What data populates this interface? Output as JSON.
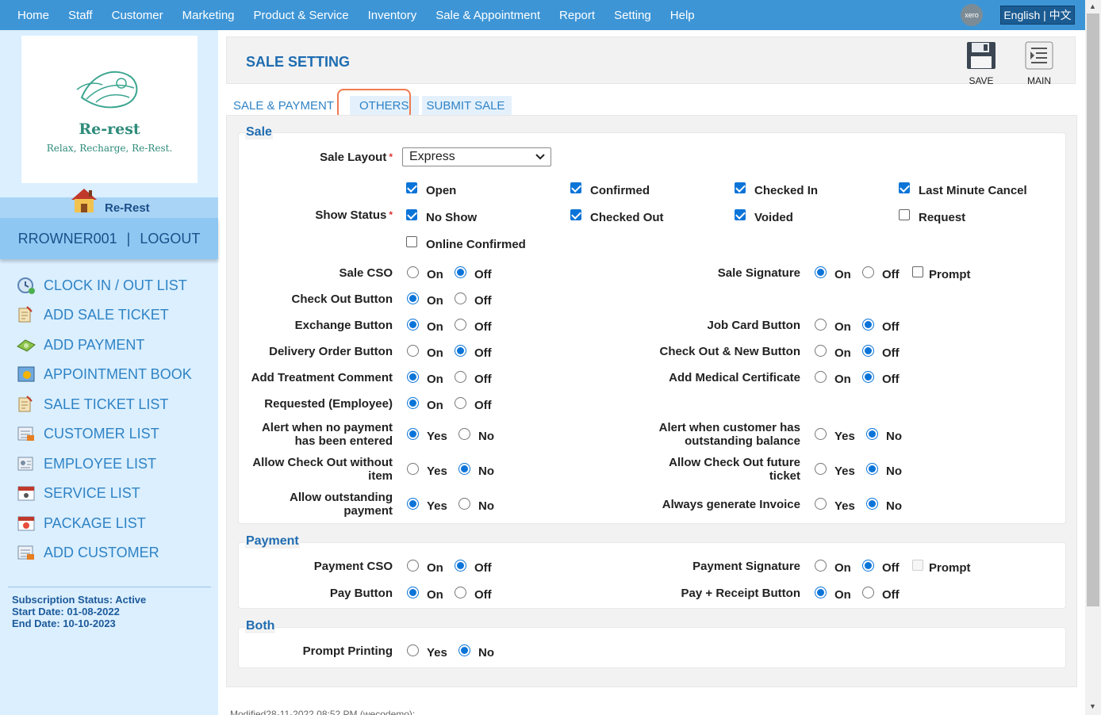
{
  "topnav": {
    "items": [
      "Home",
      "Staff",
      "Customer",
      "Marketing",
      "Product & Service",
      "Inventory",
      "Sale & Appointment",
      "Report",
      "Setting",
      "Help"
    ],
    "xero_label": "xero",
    "language": "English | 中文"
  },
  "sidebar": {
    "logo_name": "Re-rest",
    "logo_tagline": "Relax, Recharge, Re-Rest.",
    "company": "Re-Rest",
    "username": "RROWNER001",
    "separator": "|",
    "logout": "LOGOUT",
    "menu": [
      {
        "label": "CLOCK IN / OUT LIST",
        "icon": "clock-icon"
      },
      {
        "label": "ADD SALE TICKET",
        "icon": "ticket-icon"
      },
      {
        "label": "ADD PAYMENT",
        "icon": "money-icon"
      },
      {
        "label": "APPOINTMENT BOOK",
        "icon": "book-icon"
      },
      {
        "label": "SALE TICKET LIST",
        "icon": "ticket-list-icon"
      },
      {
        "label": "CUSTOMER LIST",
        "icon": "customer-list-icon"
      },
      {
        "label": "EMPLOYEE LIST",
        "icon": "employee-list-icon"
      },
      {
        "label": "SERVICE LIST",
        "icon": "service-list-icon"
      },
      {
        "label": "PACKAGE LIST",
        "icon": "package-list-icon"
      },
      {
        "label": "ADD CUSTOMER",
        "icon": "add-customer-icon"
      }
    ],
    "subscription": {
      "status": "Subscription Status: Active",
      "start": "Start Date: 01-08-2022",
      "end": "End Date: 10-10-2023"
    }
  },
  "header": {
    "title": "SALE SETTING",
    "save_label": "SAVE",
    "main_label": "MAIN"
  },
  "tabs": [
    "SALE & PAYMENT",
    "OTHERS",
    "SUBMIT SALE"
  ],
  "sections": {
    "sale": "Sale",
    "payment": "Payment",
    "both": "Both"
  },
  "sale": {
    "layout_label": "Sale Layout",
    "layout_value": "Express",
    "required_mark": "*",
    "show_status_label": "Show Status",
    "statuses": {
      "open": "Open",
      "confirmed": "Confirmed",
      "checked_in": "Checked In",
      "last_minute_cancel": "Last Minute Cancel",
      "no_show": "No Show",
      "checked_out": "Checked Out",
      "voided": "Voided",
      "request": "Request",
      "online_confirmed": "Online Confirmed"
    },
    "labels": {
      "sale_cso": "Sale CSO",
      "check_out_button": "Check Out Button",
      "exchange_button": "Exchange Button",
      "delivery_order_button": "Delivery Order Button",
      "add_treatment_comment": "Add Treatment Comment",
      "requested_employee": "Requested (Employee)",
      "alert_no_payment_1": "Alert when no payment",
      "alert_no_payment_2": "has been entered",
      "allow_checkout_without_1": "Allow Check Out without",
      "allow_checkout_without_2": "item",
      "allow_outstanding_1": "Allow outstanding",
      "allow_outstanding_2": "payment",
      "sale_signature": "Sale Signature",
      "job_card_button": "Job Card Button",
      "check_out_new_button": "Check Out & New Button",
      "add_medical_certificate": "Add Medical Certificate",
      "alert_outstanding_1": "Alert when customer has",
      "alert_outstanding_2": "outstanding balance",
      "allow_checkout_future_1": "Allow Check Out future",
      "allow_checkout_future_2": "ticket",
      "always_generate_invoice": "Always generate Invoice"
    }
  },
  "payment": {
    "payment_cso": "Payment CSO",
    "pay_button": "Pay Button",
    "payment_signature": "Payment Signature",
    "pay_receipt_button": "Pay + Receipt Button"
  },
  "both": {
    "prompt_printing": "Prompt Printing"
  },
  "options": {
    "on": "On",
    "off": "Off",
    "yes": "Yes",
    "no": "No",
    "prompt": "Prompt"
  },
  "footer": {
    "modified": "Modified28-11-2022 08:52 PM (wecodemo):"
  },
  "colors": {
    "topbar": "#3d95d6",
    "accent": "#1f6cb0",
    "link": "#2f83c5",
    "sidebar_bg": "#dbefff",
    "radio_checked": "#0b74d8",
    "tab_highlight": "#f07a4f"
  }
}
